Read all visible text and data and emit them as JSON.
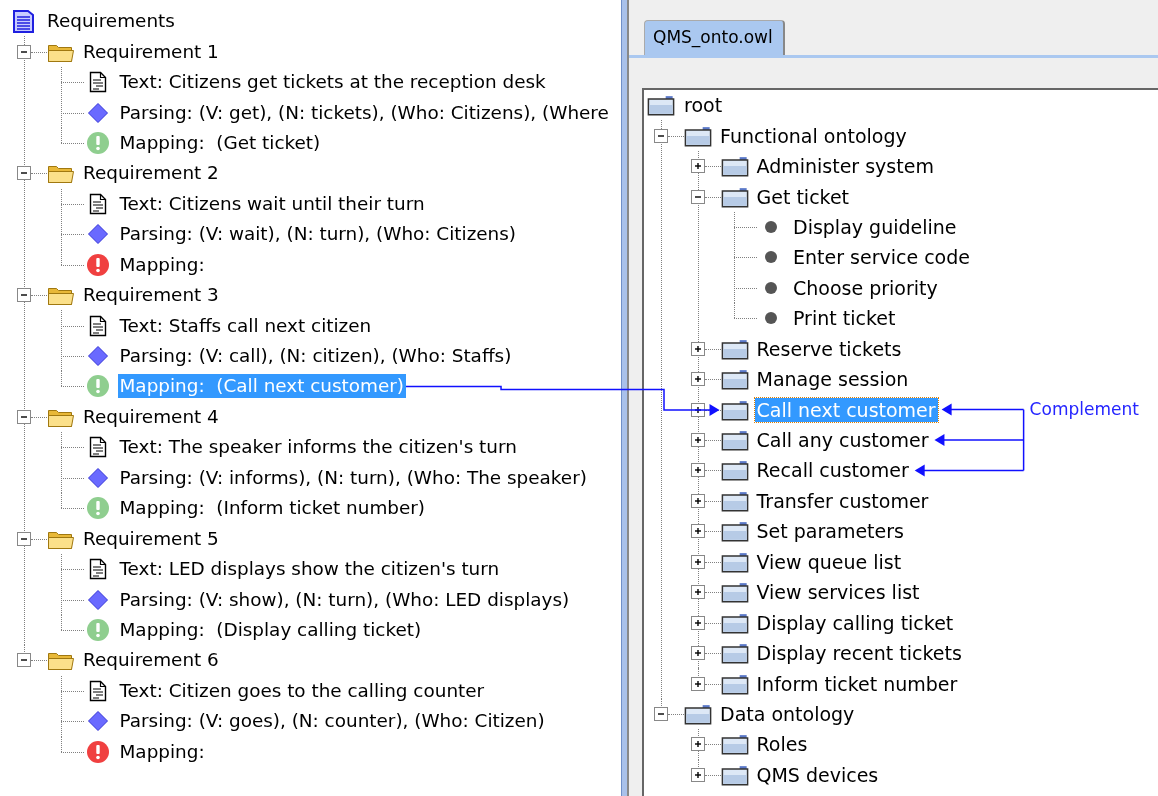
{
  "left_panel": {
    "tree": {
      "kind": "document",
      "label": "Requirements",
      "selected": false,
      "children": [
        {
          "kind": "requirement",
          "label": "Requirement 1",
          "expanded": true,
          "selected": false,
          "children": [
            {
              "kind": "text",
              "label": "Text: Citizens get tickets at the reception desk",
              "selected": false
            },
            {
              "kind": "parsing",
              "label": "Parsing: (V: get), (N: tickets), (Who: Citizens), (Where",
              "selected": false
            },
            {
              "kind": "mapping",
              "color": "#8fce8f",
              "label": "Mapping:  (Get ticket)",
              "selected": false
            }
          ]
        },
        {
          "kind": "requirement",
          "label": "Requirement 2",
          "expanded": true,
          "selected": false,
          "children": [
            {
              "kind": "text",
              "label": "Text: Citizens wait until their turn",
              "selected": false
            },
            {
              "kind": "parsing",
              "label": "Parsing: (V: wait), (N: turn), (Who: Citizens)",
              "selected": false
            },
            {
              "kind": "mapping",
              "color": "#f04040",
              "label": "Mapping:",
              "selected": false
            }
          ]
        },
        {
          "kind": "requirement",
          "label": "Requirement 3",
          "expanded": true,
          "selected": false,
          "children": [
            {
              "kind": "text",
              "label": "Text: Staffs call next citizen",
              "selected": false
            },
            {
              "kind": "parsing",
              "label": "Parsing: (V: call), (N: citizen), (Who: Staffs)",
              "selected": false
            },
            {
              "kind": "mapping",
              "color": "#8fce8f",
              "label": "Mapping:  (Call next customer)",
              "selected": true
            }
          ]
        },
        {
          "kind": "requirement",
          "label": "Requirement 4",
          "expanded": true,
          "selected": false,
          "children": [
            {
              "kind": "text",
              "label": "Text: The speaker informs the citizen's turn",
              "selected": false
            },
            {
              "kind": "parsing",
              "label": "Parsing: (V: informs), (N: turn), (Who: The speaker)",
              "selected": false
            },
            {
              "kind": "mapping",
              "color": "#8fce8f",
              "label": "Mapping:  (Inform ticket number)",
              "selected": false
            }
          ]
        },
        {
          "kind": "requirement",
          "label": "Requirement 5",
          "expanded": true,
          "selected": false,
          "children": [
            {
              "kind": "text",
              "label": "Text: LED displays show the citizen's turn",
              "selected": false
            },
            {
              "kind": "parsing",
              "label": "Parsing: (V: show), (N: turn), (Who: LED displays)",
              "selected": false
            },
            {
              "kind": "mapping",
              "color": "#8fce8f",
              "label": "Mapping:  (Display calling ticket)",
              "selected": false
            }
          ]
        },
        {
          "kind": "requirement",
          "label": "Requirement 6",
          "expanded": true,
          "selected": false,
          "children": [
            {
              "kind": "text",
              "label": "Text: Citizen goes to the calling counter",
              "selected": false
            },
            {
              "kind": "parsing",
              "label": "Parsing: (V: goes), (N: counter), (Who: Citizen)",
              "selected": false
            },
            {
              "kind": "mapping",
              "color": "#f04040",
              "label": "Mapping:",
              "selected": false
            }
          ]
        }
      ]
    }
  },
  "ontology_panel": {
    "tabs": [
      {
        "label": "QMS_onto.owl",
        "selected": true
      }
    ],
    "tree": {
      "kind": "root",
      "label": "root",
      "selected": false,
      "children": [
        {
          "kind": "class",
          "label": "Functional ontology",
          "expanded": true,
          "selected": false,
          "children": [
            {
              "kind": "class",
              "label": "Administer system",
              "expanded": false,
              "selected": false,
              "complement": false
            },
            {
              "kind": "class",
              "label": "Get ticket",
              "expanded": true,
              "selected": false,
              "complement": false,
              "children": [
                {
                  "kind": "individual",
                  "label": "Display guideline",
                  "selected": false
                },
                {
                  "kind": "individual",
                  "label": "Enter service code",
                  "selected": false
                },
                {
                  "kind": "individual",
                  "label": "Choose priority",
                  "selected": false
                },
                {
                  "kind": "individual",
                  "label": "Print ticket",
                  "selected": false
                }
              ]
            },
            {
              "kind": "class",
              "label": "Reserve tickets",
              "expanded": false,
              "selected": false,
              "complement": false
            },
            {
              "kind": "class",
              "label": "Manage session",
              "expanded": false,
              "selected": false,
              "complement": false
            },
            {
              "kind": "class",
              "label": "Call next customer",
              "expanded": false,
              "selected": true,
              "complement": true
            },
            {
              "kind": "class",
              "label": "Call any customer",
              "expanded": false,
              "selected": false,
              "complement": true
            },
            {
              "kind": "class",
              "label": "Recall customer",
              "expanded": false,
              "selected": false,
              "complement": true
            },
            {
              "kind": "class",
              "label": "Transfer customer",
              "expanded": false,
              "selected": false,
              "complement": false
            },
            {
              "kind": "class",
              "label": "Set parameters",
              "expanded": false,
              "selected": false,
              "complement": false
            },
            {
              "kind": "class",
              "label": "View queue list",
              "expanded": false,
              "selected": false,
              "complement": false
            },
            {
              "kind": "class",
              "label": "View services list",
              "expanded": false,
              "selected": false,
              "complement": false
            },
            {
              "kind": "class",
              "label": "Display calling ticket",
              "expanded": false,
              "selected": false,
              "complement": false
            },
            {
              "kind": "class",
              "label": "Display recent tickets",
              "expanded": false,
              "selected": false,
              "complement": false
            },
            {
              "kind": "class",
              "label": "Inform ticket number",
              "expanded": false,
              "selected": false,
              "complement": false
            }
          ]
        },
        {
          "kind": "class",
          "label": "Data ontology",
          "expanded": true,
          "selected": false,
          "children": [
            {
              "kind": "class",
              "label": "Roles",
              "expanded": false,
              "selected": false
            },
            {
              "kind": "class",
              "label": "QMS devices",
              "expanded": false,
              "selected": false
            }
          ]
        }
      ]
    }
  },
  "annotations": {
    "complement_label": "Complement"
  }
}
